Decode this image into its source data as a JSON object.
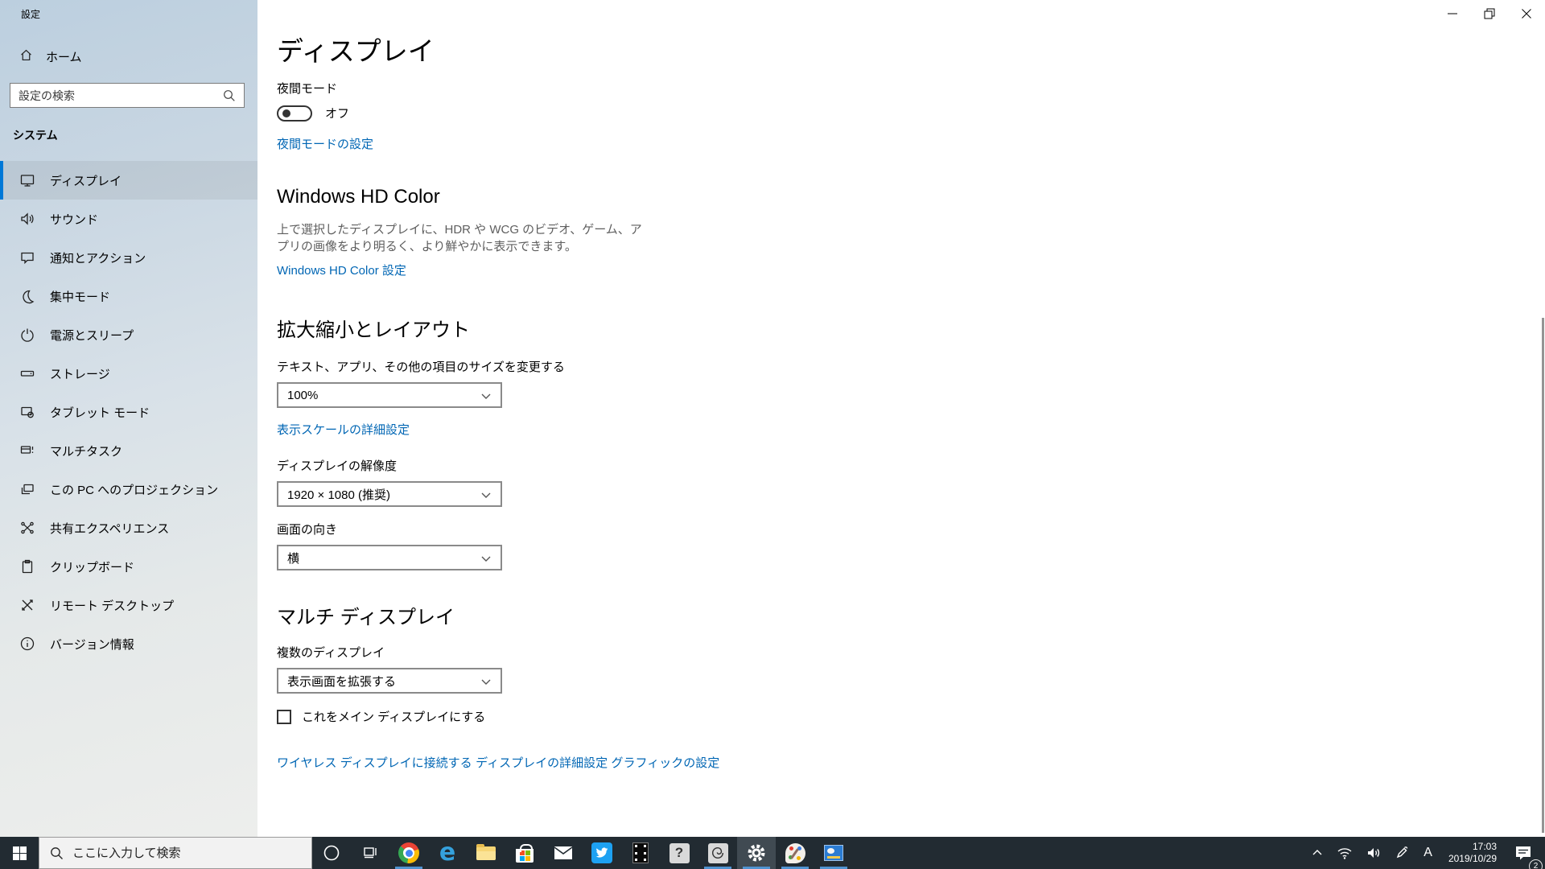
{
  "window": {
    "title": "設定"
  },
  "sidebar": {
    "home_label": "ホーム",
    "search_placeholder": "設定の検索",
    "section_label": "システム",
    "items": [
      {
        "label": "ディスプレイ",
        "icon": "display-icon",
        "selected": true
      },
      {
        "label": "サウンド",
        "icon": "sound-icon",
        "selected": false
      },
      {
        "label": "通知とアクション",
        "icon": "notifications-icon",
        "selected": false
      },
      {
        "label": "集中モード",
        "icon": "focus-assist-icon",
        "selected": false
      },
      {
        "label": "電源とスリープ",
        "icon": "power-sleep-icon",
        "selected": false
      },
      {
        "label": "ストレージ",
        "icon": "storage-icon",
        "selected": false
      },
      {
        "label": "タブレット モード",
        "icon": "tablet-mode-icon",
        "selected": false
      },
      {
        "label": "マルチタスク",
        "icon": "multitasking-icon",
        "selected": false
      },
      {
        "label": "この PC へのプロジェクション",
        "icon": "projecting-icon",
        "selected": false
      },
      {
        "label": "共有エクスペリエンス",
        "icon": "shared-experiences-icon",
        "selected": false
      },
      {
        "label": "クリップボード",
        "icon": "clipboard-icon",
        "selected": false
      },
      {
        "label": "リモート デスクトップ",
        "icon": "remote-desktop-icon",
        "selected": false
      },
      {
        "label": "バージョン情報",
        "icon": "about-icon",
        "selected": false
      }
    ]
  },
  "main": {
    "page_title": "ディスプレイ",
    "night_mode": {
      "label": "夜間モード",
      "toggle_state": "オフ",
      "toggle_on": false,
      "settings_link": "夜間モードの設定"
    },
    "hd_color": {
      "heading": "Windows HD Color",
      "description": "上で選択したディスプレイに、HDR や WCG のビデオ、ゲーム、アプリの画像をより明るく、より鮮やかに表示できます。",
      "link": "Windows HD Color 設定"
    },
    "scale_layout": {
      "heading": "拡大縮小とレイアウト",
      "scale_label": "テキスト、アプリ、その他の項目のサイズを変更する",
      "scale_value": "100%",
      "scale_link": "表示スケールの詳細設定",
      "resolution_label": "ディスプレイの解像度",
      "resolution_value": "1920 × 1080 (推奨)",
      "orientation_label": "画面の向き",
      "orientation_value": "横"
    },
    "multi_display": {
      "heading": "マルチ ディスプレイ",
      "multiple_label": "複数のディスプレイ",
      "multiple_value": "表示画面を拡張する",
      "checkbox_label": "これをメイン ディスプレイにする",
      "checkbox_checked": false,
      "links": {
        "wireless": "ワイヤレス ディスプレイに接続する",
        "advanced": "ディスプレイの詳細設定",
        "graphics": "グラフィックの設定"
      }
    }
  },
  "taskbar": {
    "search_placeholder": "ここに入力して検索",
    "running_apps": [
      "chrome",
      "spiral-app",
      "settings",
      "paint-3d",
      "system-doc-app"
    ],
    "active_app": "settings",
    "tray": {
      "ime_mode": "A",
      "time": "17:03",
      "date": "2019/10/29",
      "notification_count": "2"
    }
  },
  "colors": {
    "accent": "#0078d7",
    "link": "#0066b4",
    "taskbar_bg": "#222b32",
    "running_underline": "#5093d0",
    "sidebar_top": "#bccfdf",
    "sidebar_bottom": "#edeeec"
  }
}
